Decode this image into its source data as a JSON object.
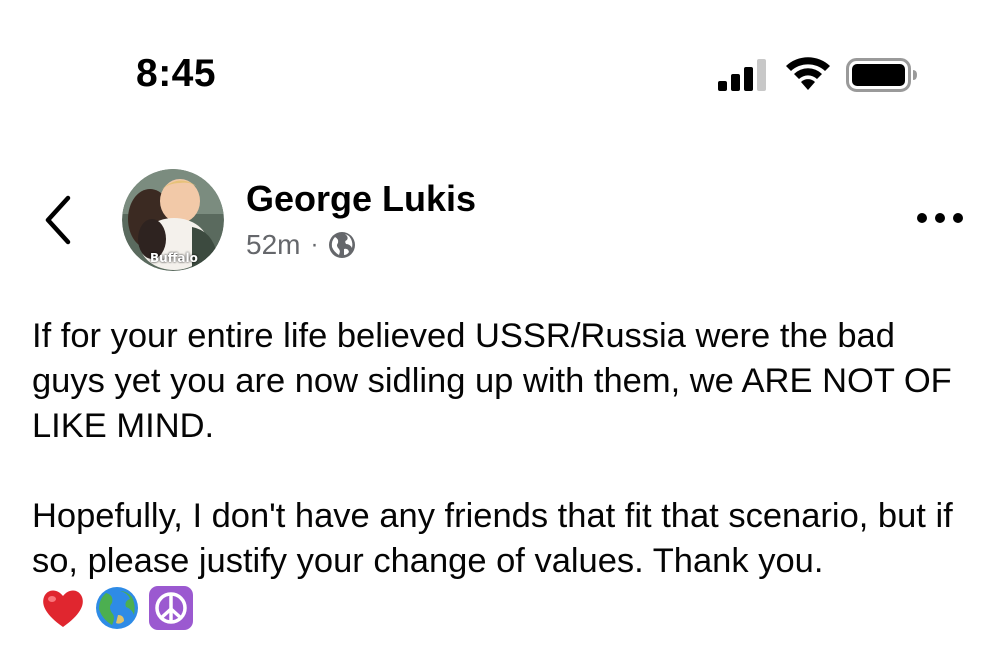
{
  "status_bar": {
    "time": "8:45",
    "icons": [
      "cellular-signal-icon",
      "wifi-icon",
      "battery-icon"
    ]
  },
  "post": {
    "author": "George Lukis",
    "avatar_badge": "Buffalo",
    "timestamp": "52m",
    "separator": "·",
    "audience_icon": "globe-icon",
    "paragraphs": [
      "If for your entire life believed USSR/Russia were the bad guys yet you are now sidling up with them, we ARE NOT OF LIKE MIND.",
      "Hopefully, I don't have any friends that fit that scenario, but if so, please justify your change of values.  Thank you."
    ],
    "trailing_emojis": [
      "red-heart-emoji",
      "globe-earth-emoji",
      "peace-symbol-emoji"
    ]
  },
  "colors": {
    "text": "#050505",
    "secondary_text": "#65676b",
    "background": "#ffffff",
    "heart": "#e0262f",
    "peace_bg": "#9b59d0"
  }
}
